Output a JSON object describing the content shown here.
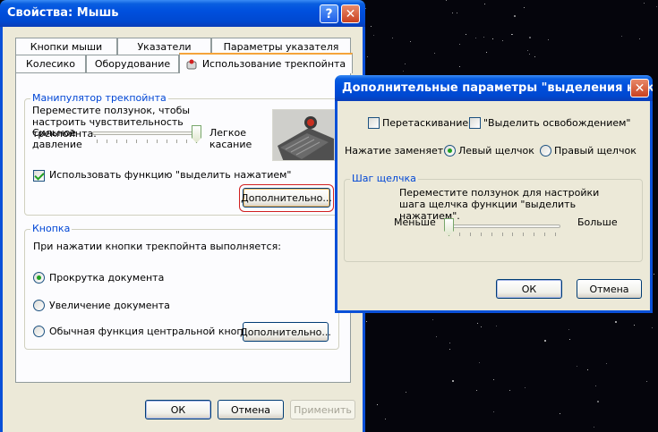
{
  "main_window": {
    "title": "Свойства: Мышь",
    "tabs_row1": [
      "Кнопки мыши",
      "Указатели",
      "Параметры указателя"
    ],
    "tabs_row2": [
      "Колесико",
      "Оборудование",
      "Использование трекпойнта"
    ],
    "group_manipulator": {
      "legend": "Манипулятор трекпойнта",
      "instruction": "Переместите ползунок, чтобы настроить чувствительность трекпойнта.",
      "left_label": "Сильное давление",
      "right_label": "Легкое касание",
      "slider_value_percent": 100,
      "checkbox_label": "Использовать функцию \"выделить нажатием\"",
      "checkbox_checked": true,
      "advanced_button": "Дополнительно..."
    },
    "group_button": {
      "legend": "Кнопка",
      "prompt": "При нажатии кнопки трекпойнта выполняется:",
      "options": [
        "Прокрутка документа",
        "Увеличение документа",
        "Обычная функция центральной кнопки"
      ],
      "selected_index": 0,
      "advanced_button": "Дополнительно..."
    },
    "buttons": {
      "ok": "ОК",
      "cancel": "Отмена",
      "apply": "Применить"
    }
  },
  "sub_window": {
    "title": "Дополнительные параметры \"выделения нажа...",
    "drag_label": "Перетаскивание",
    "drag_checked": false,
    "release_label": "\"Выделить освобождением\"",
    "release_checked": false,
    "replace_label": "Нажатие заменяет",
    "left_click_label": "Левый щелчок",
    "right_click_label": "Правый щелчок",
    "left_click_selected": true,
    "step_group": {
      "legend": "Шаг щелчка",
      "instruction": "Переместите ползунок для настройки шага щелчка функции \"выделить нажатием\".",
      "less_label": "Меньше",
      "more_label": "Больше",
      "slider_value_percent": 0
    },
    "buttons": {
      "ok": "ОК",
      "cancel": "Отмена"
    }
  },
  "colors": {
    "titlebar_blue": "#0050de",
    "dialog_face": "#ece9d8",
    "group_legend_blue": "#0046d5",
    "highlight_red": "#d12020",
    "tab_active_orange": "#f5a43a"
  }
}
